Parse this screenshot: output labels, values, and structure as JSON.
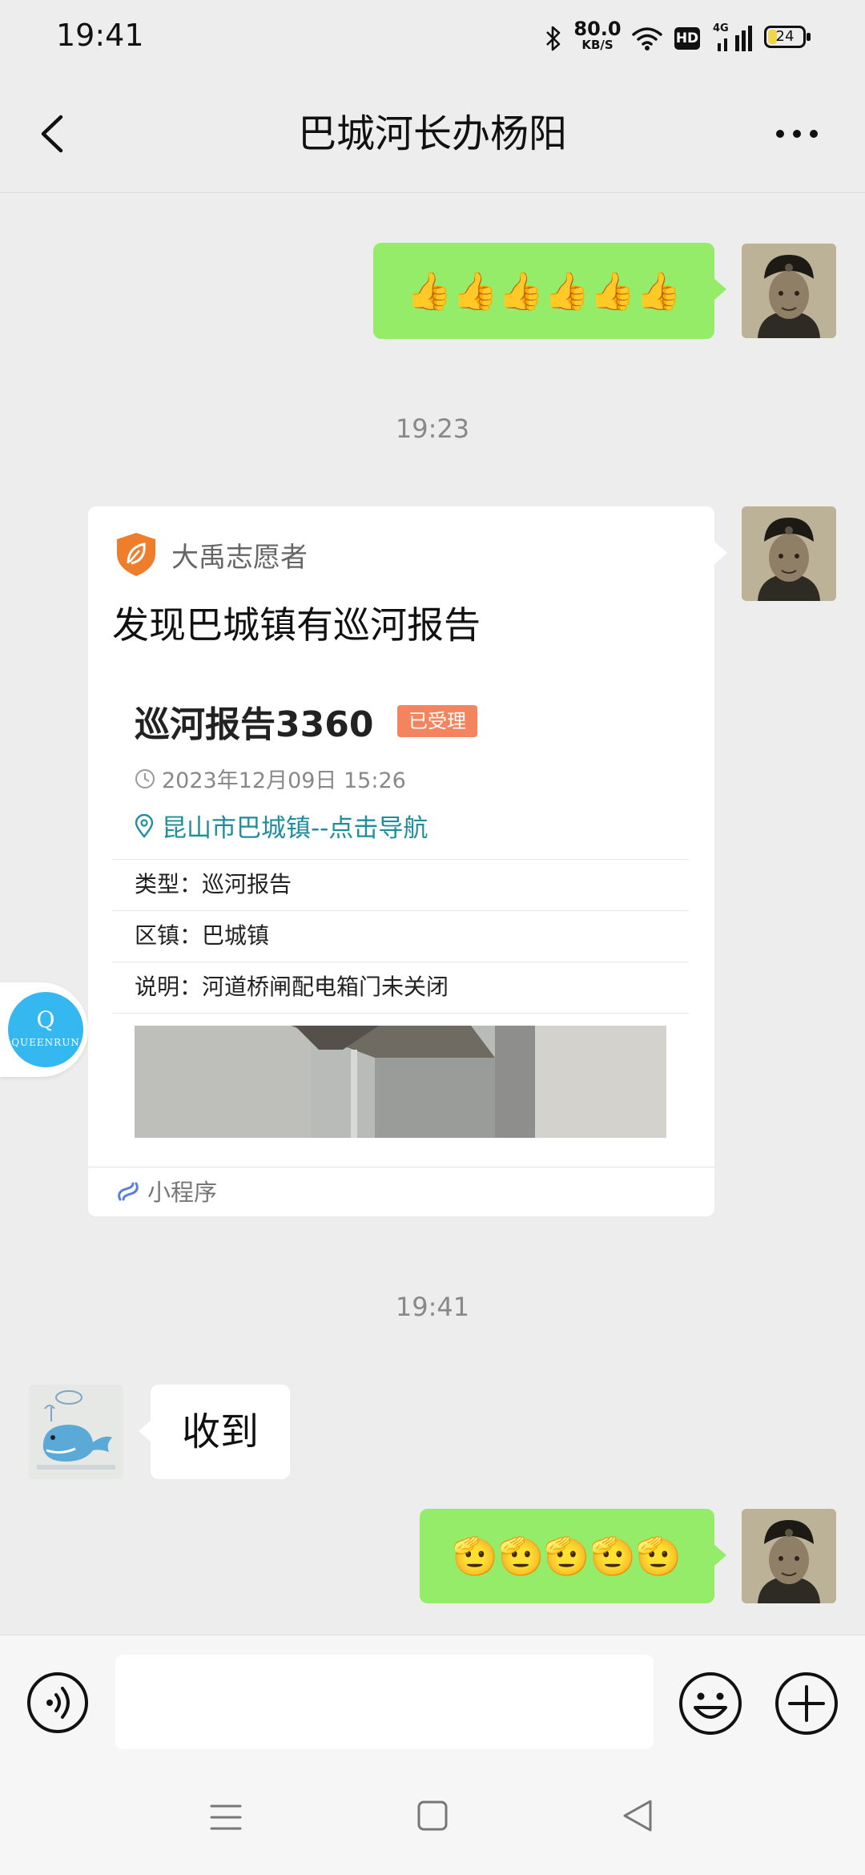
{
  "status_bar": {
    "time": "19:41",
    "net_speed_value": "80.0",
    "net_speed_unit": "KB/S",
    "hd_label": "HD",
    "network_label": "4G",
    "battery_level": "24",
    "icons": [
      "bluetooth-icon",
      "wifi-icon",
      "signal-icon",
      "battery-icon"
    ]
  },
  "header": {
    "title": "巴城河长办杨阳",
    "icons": [
      "back-chevron-icon",
      "more-dots-icon"
    ]
  },
  "messages": {
    "first_emoji": "👍👍👍👍👍👍",
    "time_1": "19:23",
    "card": {
      "source_name": "大禹志愿者",
      "title": "发现巴城镇有巡河报告",
      "report_title": "巡河报告3360",
      "status_badge": "已受理",
      "datetime": "2023年12月09日 15:26",
      "location_link": "昆山市巴城镇--点击导航",
      "rows": [
        {
          "text": "类型：巡河报告"
        },
        {
          "text": "区镇：巴城镇"
        },
        {
          "text": "说明：河道桥闸配电箱门未关闭"
        }
      ],
      "footer_label": "小程序"
    },
    "time_2": "19:41",
    "reply_text": "收到",
    "last_emoji": "🫡🫡🫡🫡🫡"
  },
  "floating_badge": {
    "letter": "Q",
    "text": "QUEENRUN"
  },
  "input_bar": {
    "placeholder": ""
  },
  "colors": {
    "background": "#ededed",
    "my_bubble": "#95ec69",
    "their_bubble": "#ffffff",
    "link": "#1e8e9c",
    "badge": "#f3845f",
    "shield": "#ee7d2c"
  }
}
